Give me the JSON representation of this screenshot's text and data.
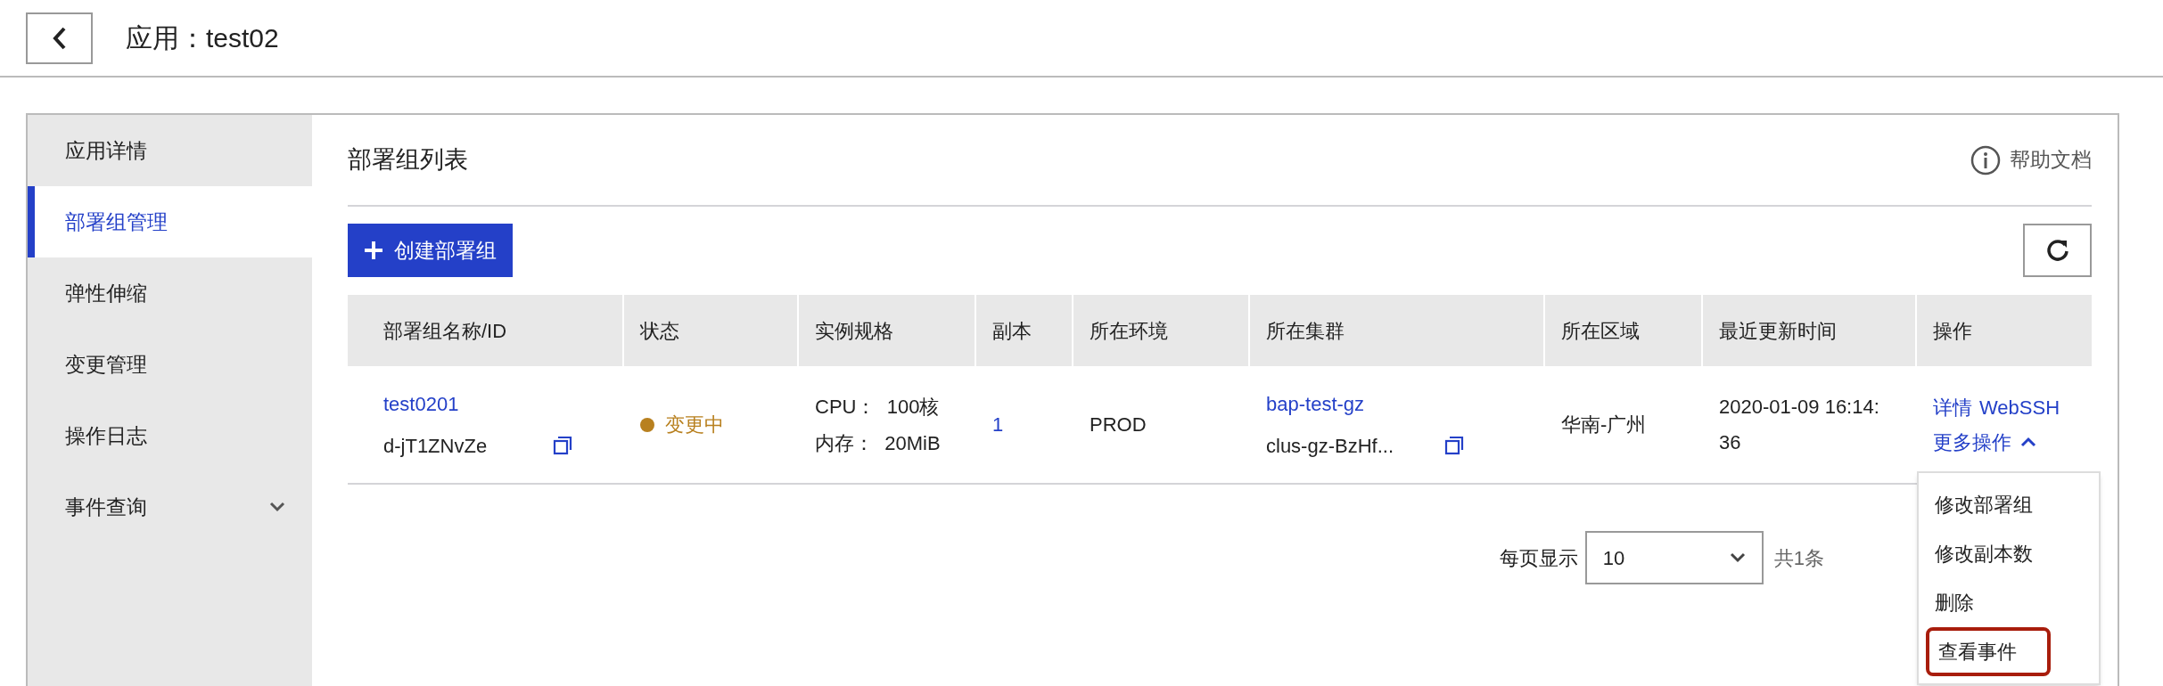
{
  "header": {
    "title": "应用：test02"
  },
  "sidebar": {
    "items": [
      {
        "label": "应用详情",
        "selected": false
      },
      {
        "label": "部署组管理",
        "selected": true
      },
      {
        "label": "弹性伸缩",
        "selected": false
      },
      {
        "label": "变更管理",
        "selected": false
      },
      {
        "label": "操作日志",
        "selected": false
      },
      {
        "label": "事件查询",
        "selected": false,
        "expanded": false
      }
    ]
  },
  "section": {
    "title": "部署组列表",
    "help_link": "帮助文档"
  },
  "create_button": "创建部署组",
  "table": {
    "columns": [
      "部署组名称/ID",
      "状态",
      "实例规格",
      "副本",
      "所在环境",
      "所在集群",
      "所在区域",
      "最近更新时间",
      "操作"
    ],
    "rows": [
      {
        "name": "test0201",
        "id": "d-jT1ZNvZe",
        "status": {
          "kind": "changing",
          "text": "变更中"
        },
        "spec": [
          "CPU：  100核",
          "内存：  20MiB"
        ],
        "replicas": "1",
        "environment": "PROD",
        "cluster_name": "bap-test-gz",
        "cluster_id": "clus-gz-BzHf...",
        "region": "华南-广州",
        "updated": "2020-01-09 16:14:36",
        "actions": [
          "详情",
          "WebSSH"
        ],
        "more": {
          "label": "更多操作",
          "expanded": true,
          "items": [
            {
              "label": "修改部署组",
              "highlighted": false
            },
            {
              "label": "修改副本数",
              "highlighted": false
            },
            {
              "label": "删除",
              "highlighted": false
            },
            {
              "label": "查看事件",
              "highlighted": true
            }
          ]
        }
      }
    ]
  },
  "pagination": {
    "page_size_label": "每页显示",
    "page_size": "10",
    "total": "共1条"
  }
}
